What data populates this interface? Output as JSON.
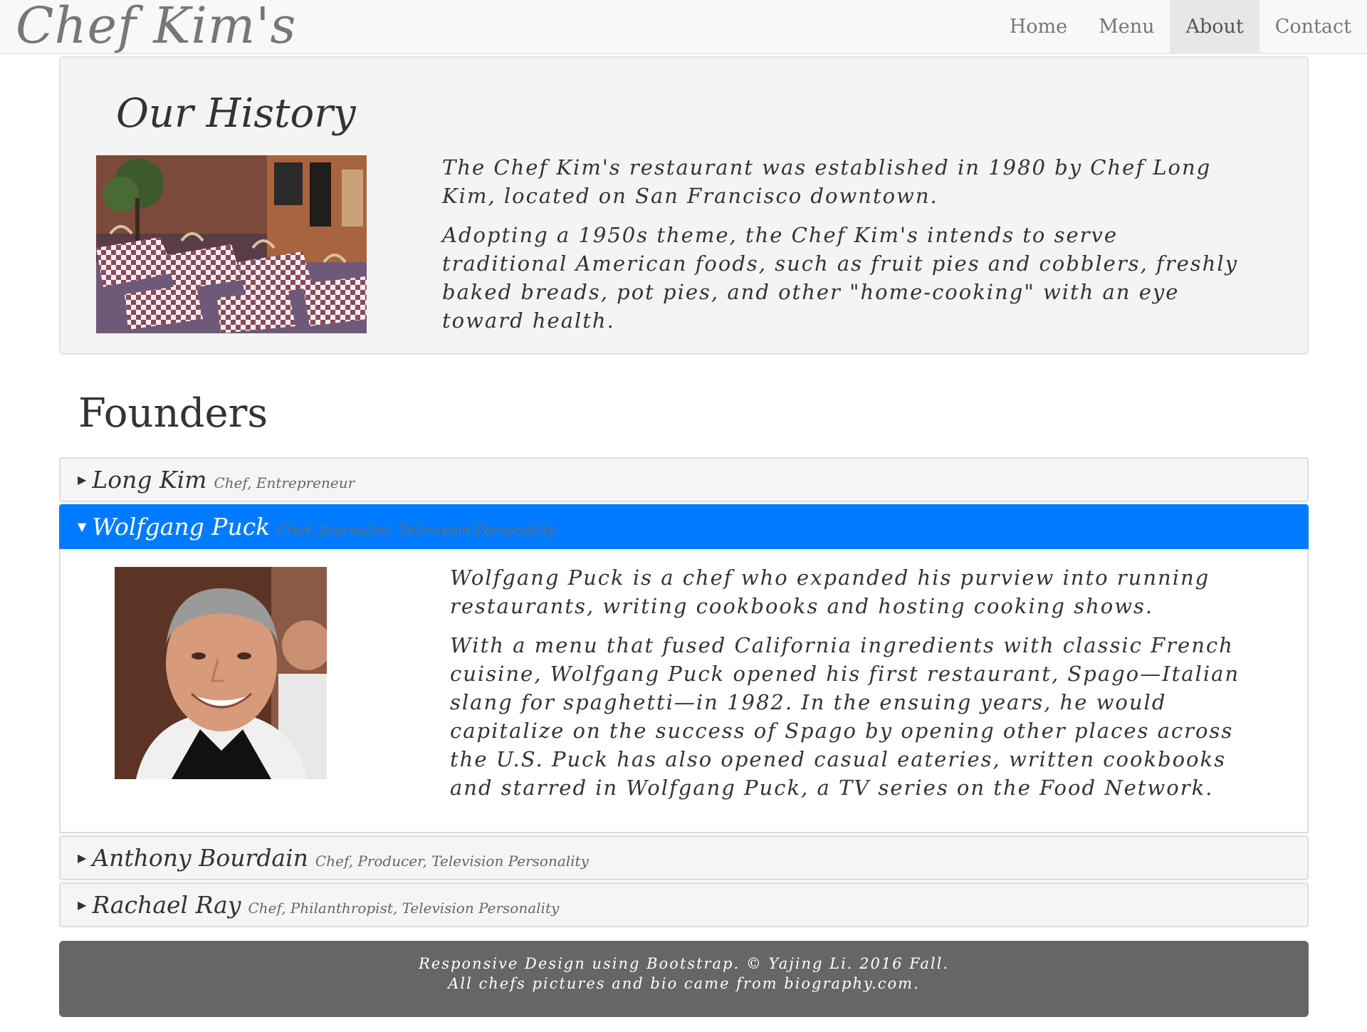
{
  "navbar": {
    "brand": "Chef Kim's",
    "items": [
      "Home",
      "Menu",
      "About",
      "Contact"
    ],
    "active": "About"
  },
  "history": {
    "title": "Our History",
    "paragraphs": [
      "The Chef Kim's restaurant was established in 1980 by Chef Long Kim, located on San Francisco downtown.",
      "Adopting a 1950s theme, the Chef Kim's intends to serve traditional American foods, such as fruit pies and cobblers, freshly baked breads, pot pies, and other \"home-cooking\" with an eye toward health."
    ]
  },
  "founders": {
    "title": "Founders",
    "panels": [
      {
        "name": "Long Kim",
        "role": "Chef, Entrepreneur"
      },
      {
        "name": "Wolfgang Puck",
        "role": "Chef, Journalist, Television Personality"
      },
      {
        "name": "Anthony Bourdain",
        "role": "Chef, Producer, Television Personality"
      },
      {
        "name": "Rachael Ray",
        "role": "Chef, Philanthropist, Television Personality"
      }
    ],
    "open_panel_text": [
      "Wolfgang Puck is a chef who expanded his purview into running restaurants, writing cookbooks and hosting cooking shows.",
      "With a menu that fused California ingredients with classic French cuisine, Wolfgang Puck opened his first restaurant, Spago—Italian slang for spaghetti—in 1982. In the ensuing years, he would capitalize on the success of Spago by opening other places across the U.S. Puck has also opened casual eateries, written cookbooks and starred in Wolfgang Puck, a TV series on the Food Network."
    ]
  },
  "footer": {
    "line1": "Responsive Design using Bootstrap. © Yajing Li. 2016 Fall.",
    "line2": "All chefs pictures and bio came from biography.com."
  },
  "colors": {
    "accent": "#007bff",
    "footer_bg": "#666666",
    "navbar_bg": "#f8f8f8",
    "well_bg": "#f4f4f4"
  }
}
